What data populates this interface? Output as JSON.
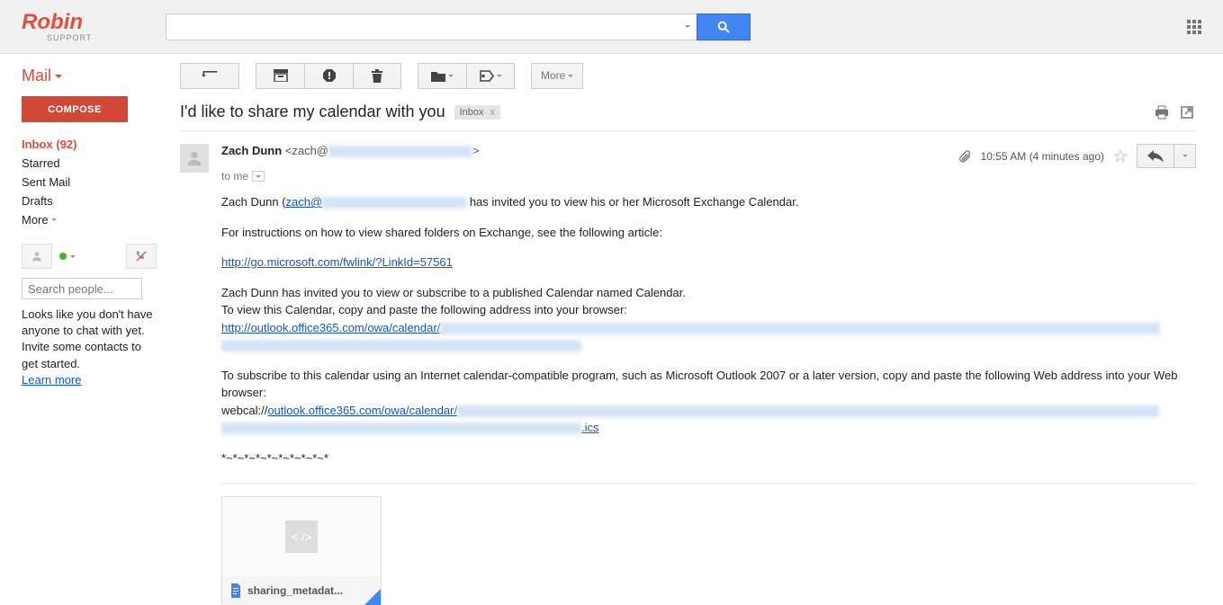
{
  "logo": {
    "main": "Robin",
    "sub": "SUPPORT"
  },
  "search": {
    "placeholder": ""
  },
  "sidebar": {
    "mail_label": "Mail",
    "compose": "COMPOSE",
    "items": [
      {
        "label": "Inbox (92)",
        "active": true
      },
      {
        "label": "Starred",
        "active": false
      },
      {
        "label": "Sent Mail",
        "active": false
      },
      {
        "label": "Drafts",
        "active": false
      }
    ],
    "more": "More",
    "search_people_placeholder": "Search people...",
    "empty_chat": "Looks like you don't have anyone to chat with yet. Invite some contacts to get started.",
    "learn_more": "Learn more"
  },
  "toolbar": {
    "more": "More"
  },
  "message": {
    "subject": "I'd like to share my calendar with you",
    "label": "Inbox",
    "sender_name": "Zach Dunn",
    "sender_email_prefix": "<zach@",
    "sender_email_suffix": ">",
    "to_line": "to me",
    "time": "10:55 AM (4 minutes ago)",
    "body": {
      "l1a": "Zach Dunn (",
      "l1b": "zach@",
      "l1c": " has invited you to view his or her Microsoft Exchange Calendar.",
      "l2": "For instructions on how to view shared folders on Exchange, see the following article:",
      "link1": "http://go.microsoft.com/fwlink/?LinkId=57561",
      "l3": "Zach Dunn has invited you to view or subscribe to a published Calendar named Calendar.",
      "l4": "To view this Calendar, copy and paste the following address into your browser:",
      "link2": "http://outlook.office365.com/owa/calendar/",
      "l5": "To subscribe to this calendar using an Internet calendar-compatible program, such as Microsoft Outlook 2007 or a later version, copy and paste the following Web address into your Web browser:",
      "l6a": "webcal://",
      "link3a": "outlook.office365.com/owa/calendar/",
      "link3b": ".ics",
      "footer": "*~*~*~*~*~*~*~*~*~*"
    },
    "attachment": {
      "name": "sharing_metadat...",
      "chip": "< />"
    }
  }
}
